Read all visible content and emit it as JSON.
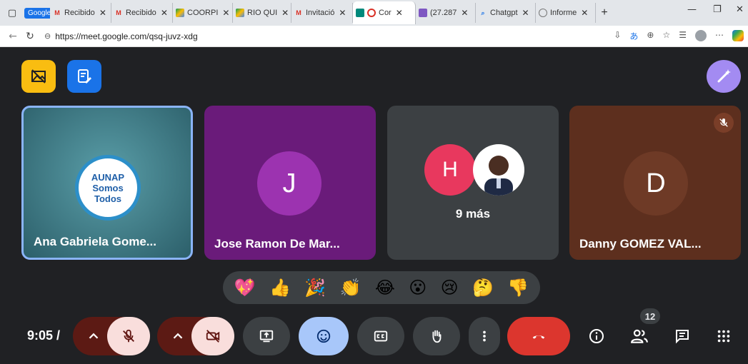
{
  "browser": {
    "tabs": [
      {
        "label": "Google",
        "icon": "google-chip"
      },
      {
        "label": "Recibido",
        "icon": "gmail-icon"
      },
      {
        "label": "Recibido",
        "icon": "gmail-icon"
      },
      {
        "label": "COORPI",
        "icon": "drive-icon"
      },
      {
        "label": "RIO QUI",
        "icon": "drive-icon"
      },
      {
        "label": "Invitació",
        "icon": "gmail-icon"
      },
      {
        "label": "Cor",
        "icon": "meet-icon",
        "active": true
      },
      {
        "label": "(27.287",
        "icon": "mail-icon"
      },
      {
        "label": "Chatgpt",
        "icon": "search-icon"
      },
      {
        "label": "Informe",
        "icon": "web-icon"
      }
    ],
    "url": "https://meet.google.com/qsq-juvz-xdg"
  },
  "meeting": {
    "participants": [
      {
        "name": "Ana Gabriela Gome...",
        "avatar_text": "AUNAP Somos Todos",
        "bg": "#2f6f79"
      },
      {
        "name": "Jose Ramon De Mar...",
        "avatar_letter": "J",
        "bg": "#6a1b7a"
      },
      {
        "name": "",
        "avatar_letter": "H",
        "extra": "9 más",
        "bg": "#3c4043"
      },
      {
        "name": "Danny GOMEZ VAL...",
        "avatar_letter": "D",
        "bg": "#5d2f1e",
        "muted": true
      }
    ],
    "reactions": [
      "💖",
      "👍",
      "🎉",
      "👏",
      "😂",
      "😮",
      "😢",
      "🤔",
      "👎"
    ],
    "clock": "9:05 /",
    "people_count": "12"
  }
}
